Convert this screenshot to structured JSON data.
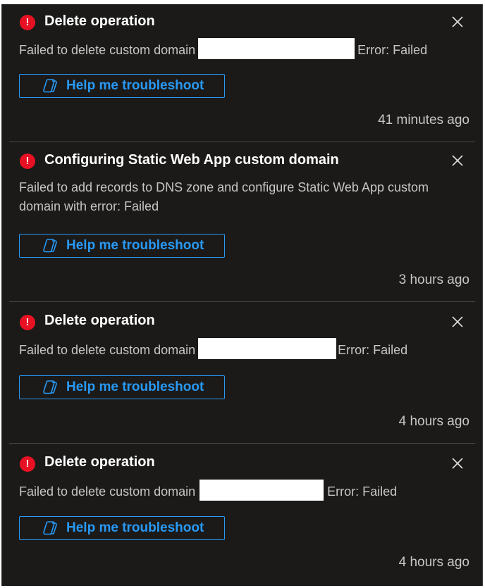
{
  "notifications": [
    {
      "title": "Delete operation",
      "message_prefix": "Failed to delete custom domain",
      "message_suffix": "Error: Failed",
      "button_label": "Help me troubleshoot",
      "timestamp": "41 minutes ago"
    },
    {
      "title": "Configuring Static Web App custom domain",
      "message": "Failed to add records to DNS zone and configure Static Web App custom domain with error: Failed",
      "button_label": "Help me troubleshoot",
      "timestamp": "3 hours ago"
    },
    {
      "title": "Delete operation",
      "message_prefix": "Failed to delete custom domain",
      "message_suffix": "Error: Failed",
      "button_label": "Help me troubleshoot",
      "timestamp": "4 hours ago"
    },
    {
      "title": "Delete operation",
      "message_prefix": "Failed to delete custom domain",
      "message_suffix": "Error: Failed",
      "button_label": "Help me troubleshoot",
      "timestamp": "4 hours ago"
    }
  ],
  "icons": {
    "status": "error-icon",
    "status_glyph": "!",
    "dismiss": "close-icon",
    "assistant": "copilot-icon"
  },
  "colors": {
    "panel_background": "#1b1a19",
    "error": "#e81123",
    "accent": "#2899f5",
    "title_text": "#ffffff",
    "body_text": "#c8c6c4",
    "redaction": "#ffffff"
  }
}
